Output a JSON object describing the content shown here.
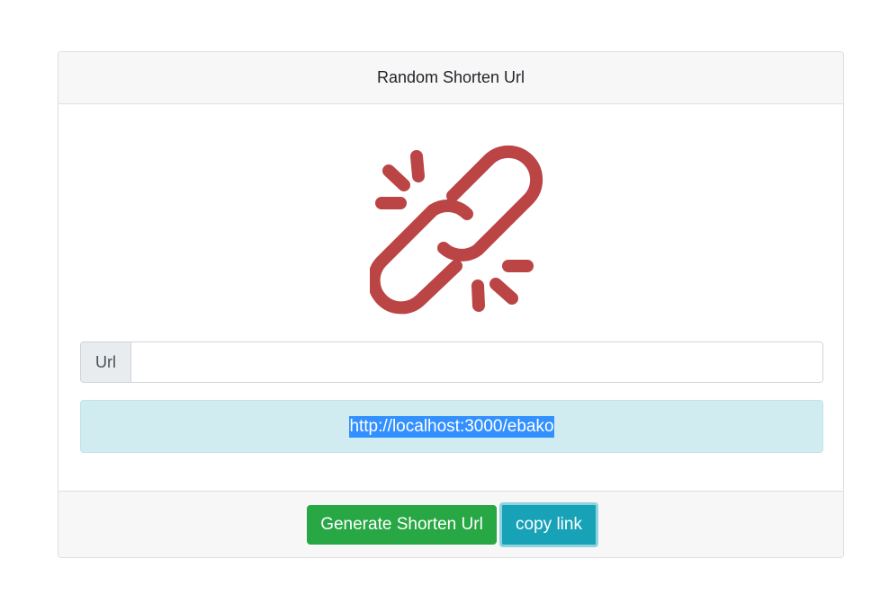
{
  "card": {
    "title": "Random Shorten Url"
  },
  "icons": {
    "logo": "broken-link-icon",
    "logo_color": "#bb4444"
  },
  "form": {
    "url_label": "Url",
    "url_value": "",
    "url_placeholder": ""
  },
  "result": {
    "short_url": "http://localhost:3000/ebako"
  },
  "footer": {
    "generate_label": "Generate Shorten Url",
    "copy_label": "copy link"
  },
  "colors": {
    "generate_button": "#28a745",
    "copy_button": "#17a2b8",
    "alert_background": "#d1ecf1",
    "selection_highlight": "#3390ff"
  }
}
